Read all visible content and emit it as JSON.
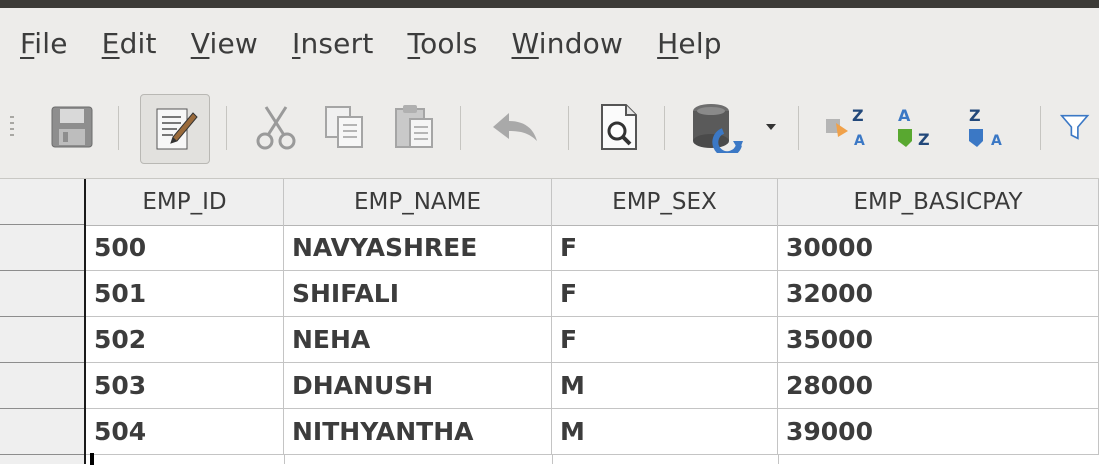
{
  "menubar": {
    "items": [
      {
        "label": "File",
        "ul": "F",
        "rest": "ile"
      },
      {
        "label": "Edit",
        "ul": "E",
        "rest": "dit"
      },
      {
        "label": "View",
        "ul": "V",
        "rest": "iew"
      },
      {
        "label": "Insert",
        "ul": "I",
        "rest": "nsert"
      },
      {
        "label": "Tools",
        "ul": "T",
        "rest": "ools"
      },
      {
        "label": "Window",
        "ul": "W",
        "rest": "indow"
      },
      {
        "label": "Help",
        "ul": "H",
        "rest": "elp"
      }
    ]
  },
  "toolbar": {
    "icons": [
      "save-icon",
      "edit-mode-icon",
      "cut-icon",
      "copy-icon",
      "paste-icon",
      "undo-icon",
      "print-preview-icon",
      "database-icon",
      "dropdown-arrow-icon",
      "sort-ascending-icon",
      "sort-a-z-icon",
      "sort-z-a-icon",
      "filter-icon"
    ]
  },
  "table": {
    "columns": [
      "EMP_ID",
      "EMP_NAME",
      "EMP_SEX",
      "EMP_BASICPAY"
    ],
    "rows": [
      [
        "500",
        "NAVYASHREE",
        "F",
        "30000"
      ],
      [
        "501",
        "SHIFALI",
        "F",
        "32000"
      ],
      [
        "502",
        "NEHA",
        "F",
        "35000"
      ],
      [
        "503",
        "DHANUSH",
        "M",
        "28000"
      ],
      [
        "504",
        "NITHYANTHA",
        "M",
        "39000"
      ]
    ]
  },
  "colors": {
    "menubar_bg": "#edecea",
    "header_bg": "#efefef",
    "text": "#3c3c3c"
  }
}
